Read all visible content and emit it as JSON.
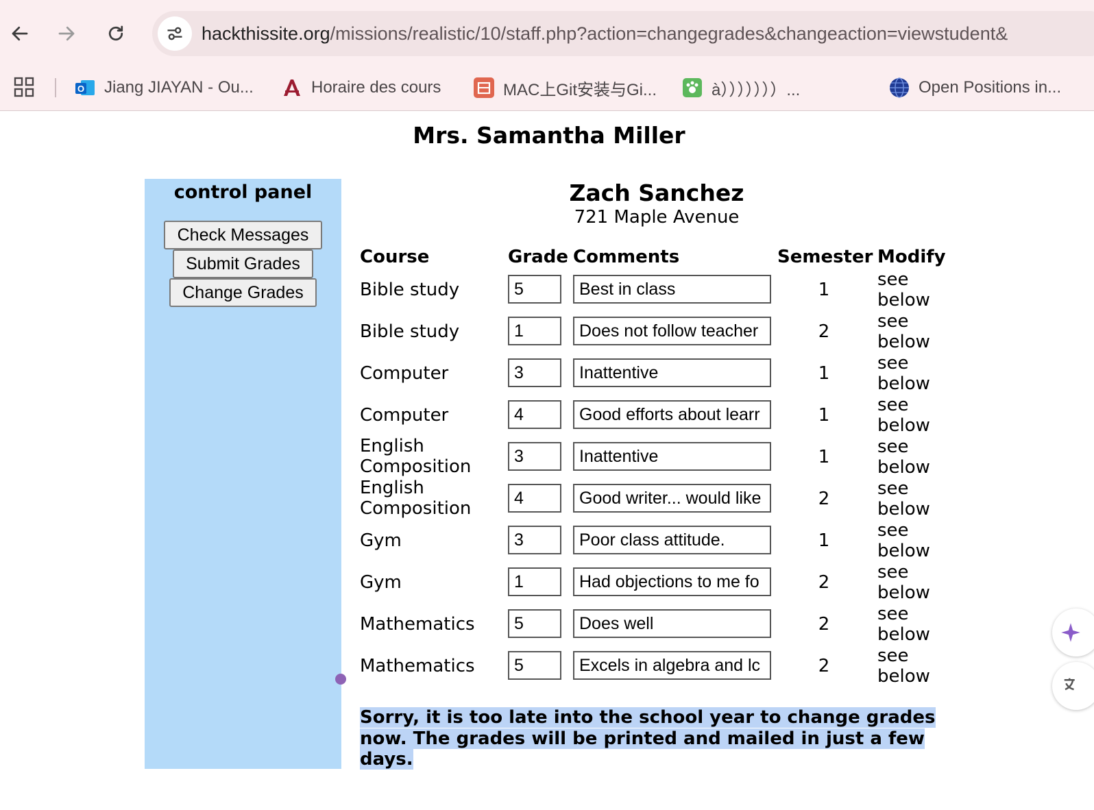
{
  "browser": {
    "url_host": "hackthissite.org",
    "url_path": "/missions/realistic/10/staff.php?action=changegrades&changeaction=viewstudent&",
    "bookmarks": [
      {
        "label": "Jiang JIAYAN - Ou...",
        "icon": "outlook-icon"
      },
      {
        "label": "Horaire des cours",
        "icon": "university-logo-icon"
      },
      {
        "label": "MAC上Git安装与Gi...",
        "icon": "jian-icon"
      },
      {
        "label": "à）））））））...",
        "icon": "paw-icon"
      },
      {
        "label": "Open Positions in...",
        "icon": "globe-icon"
      }
    ]
  },
  "page": {
    "teacher_name": "Mrs. Samantha Miller",
    "control_panel": {
      "title": "control panel",
      "buttons": [
        "Check Messages",
        "Submit Grades",
        "Change Grades"
      ]
    },
    "student": {
      "name": "Zach Sanchez",
      "address": "721 Maple Avenue"
    },
    "table": {
      "headers": {
        "course": "Course",
        "grade": "Grade",
        "comments": "Comments",
        "semester": "Semester",
        "modify": "Modify"
      },
      "rows": [
        {
          "course": "Bible study",
          "grade": "5",
          "comment": "Best in class",
          "semester": "1",
          "modify": "see below"
        },
        {
          "course": "Bible study",
          "grade": "1",
          "comment": "Does not follow teacher",
          "semester": "2",
          "modify": "see below"
        },
        {
          "course": "Computer",
          "grade": "3",
          "comment": "Inattentive",
          "semester": "1",
          "modify": "see below"
        },
        {
          "course": "Computer",
          "grade": "4",
          "comment": "Good efforts about learr",
          "semester": "1",
          "modify": "see below"
        },
        {
          "course": "English Composition",
          "grade": "3",
          "comment": "Inattentive",
          "semester": "1",
          "modify": "see below"
        },
        {
          "course": "English Composition",
          "grade": "4",
          "comment": "Good writer... would like",
          "semester": "2",
          "modify": "see below"
        },
        {
          "course": "Gym",
          "grade": "3",
          "comment": "Poor class attitude.",
          "semester": "1",
          "modify": "see below"
        },
        {
          "course": "Gym",
          "grade": "1",
          "comment": "Had objections to me fo",
          "semester": "2",
          "modify": "see below"
        },
        {
          "course": "Mathematics",
          "grade": "5",
          "comment": "Does well",
          "semester": "2",
          "modify": "see below"
        },
        {
          "course": "Mathematics",
          "grade": "5",
          "comment": "Excels in algebra and lc",
          "semester": "2",
          "modify": "see below"
        }
      ]
    },
    "notice": "Sorry, it is too late into the school year to change grades now. The grades will be printed and mailed in just a few days."
  },
  "colors": {
    "panel_bg": "#b4daf9",
    "selection": "#bcd4f6",
    "chrome_bg": "#fbeef0"
  }
}
